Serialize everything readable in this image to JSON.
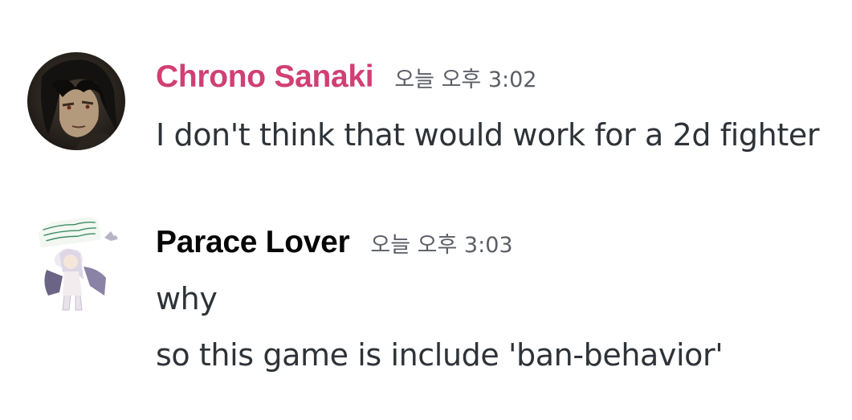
{
  "messages": [
    {
      "username": "Chrono Sanaki",
      "username_color": "#d13f74",
      "timestamp": "오늘 오후 3:02",
      "avatar": "anime-character-avatar",
      "lines": [
        "I don't think that would work for a 2d fighter"
      ]
    },
    {
      "username": "Parace Lover",
      "username_color": "#060607",
      "timestamp": "오늘 오후 3:03",
      "avatar": "anime-character-avatar",
      "lines": [
        "why",
        "so this game is include 'ban-behavior'"
      ]
    }
  ]
}
